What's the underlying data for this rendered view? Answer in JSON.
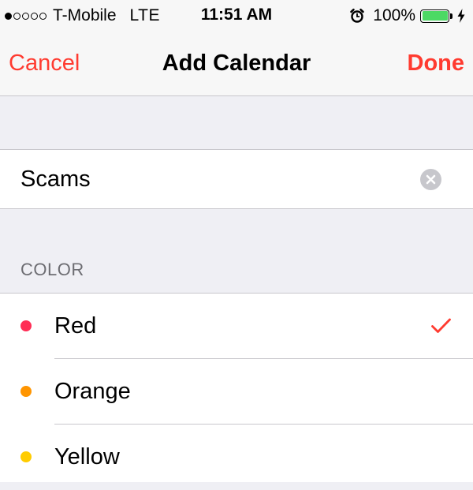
{
  "status_bar": {
    "signal_filled": 1,
    "signal_total": 5,
    "carrier": "T-Mobile",
    "network": "LTE",
    "time": "11:51 AM",
    "battery_percent": "100%",
    "battery_level": 1.0,
    "battery_color": "#4cd964",
    "icons": [
      "alarm-clock-icon",
      "battery-icon",
      "charging-bolt-icon"
    ]
  },
  "nav": {
    "cancel_label": "Cancel",
    "title": "Add Calendar",
    "done_label": "Done",
    "accent_color": "#ff3b30"
  },
  "name_field": {
    "value": "Scams",
    "clear_icon": "clear-x-icon"
  },
  "color_section": {
    "header": "COLOR",
    "selected": "Red",
    "options": [
      {
        "label": "Red",
        "color": "#ff2d55",
        "selected": true
      },
      {
        "label": "Orange",
        "color": "#ff9500",
        "selected": false
      },
      {
        "label": "Yellow",
        "color": "#ffcc00",
        "selected": false
      }
    ]
  }
}
